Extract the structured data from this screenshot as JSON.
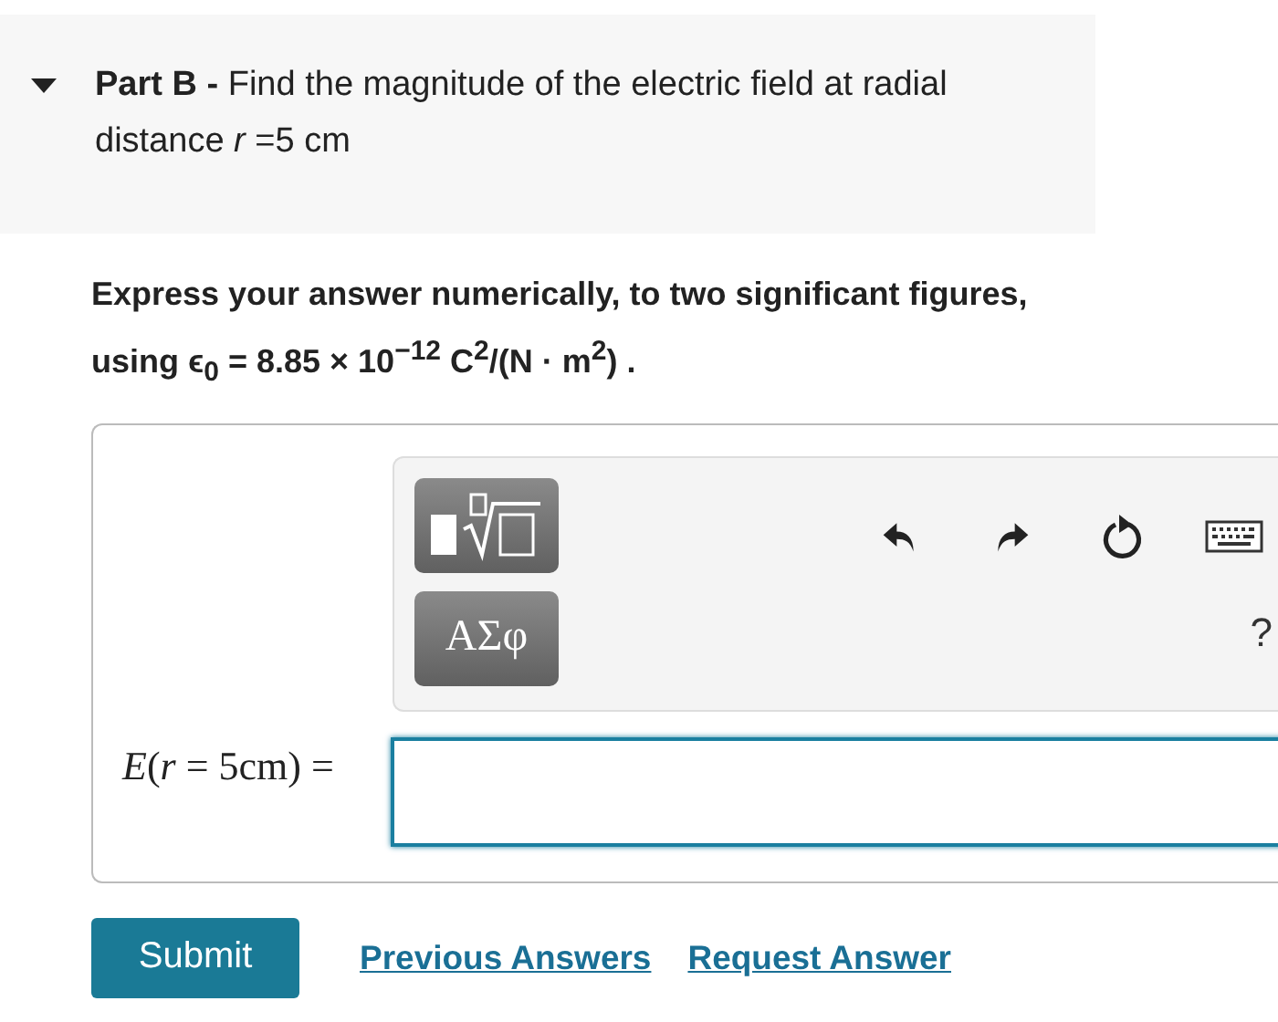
{
  "part": {
    "expanded": true,
    "title": "**Part B -** Find the magnitude of the electric field at radial distance *r* =5 cm"
  },
  "instructions": "**Express your answer numerically, to two significant figures, using** ϵ$_{0}$ = 8.85 × 10$^{−12}$ C$^{2}$/(N · m$^{2}$) .",
  "toolbar": {
    "greek_button": "ΑΣφ",
    "help": "?"
  },
  "answer": {
    "label": "*E*(*r* = 5cm) ="
  },
  "buttons": {
    "submit": "Submit",
    "links": [
      "Previous Answers",
      "Request Answer"
    ]
  }
}
